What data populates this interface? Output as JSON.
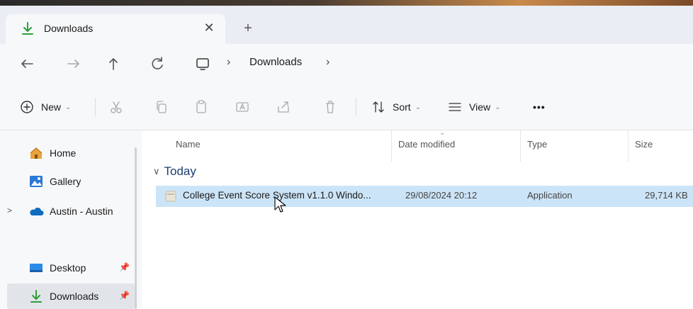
{
  "tab": {
    "icon": "download-arrow-icon",
    "label": "Downloads",
    "close_glyph": "✕",
    "new_tab_glyph": "+"
  },
  "navigation": {
    "back": "back-arrow-icon",
    "forward": "forward-arrow-icon",
    "up": "up-arrow-icon",
    "refresh": "refresh-icon"
  },
  "address_bar": {
    "root_icon": "computer-icon",
    "separator": "›",
    "path": [
      "Downloads"
    ]
  },
  "toolbar": {
    "new_label": "New",
    "sort_label": "Sort",
    "view_label": "View",
    "more_label": "•••",
    "caret": "⌄"
  },
  "sidebar": {
    "items": [
      {
        "label": "Home",
        "icon": "home-icon"
      },
      {
        "label": "Gallery",
        "icon": "gallery-icon"
      },
      {
        "label": "Austin - Austin",
        "icon": "onedrive-cloud-icon"
      },
      {
        "label": "Desktop",
        "icon": "desktop-icon"
      },
      {
        "label": "Downloads",
        "icon": "download-arrow-icon"
      }
    ],
    "expand_glyph": ">",
    "pin_glyph": "📌"
  },
  "columns": {
    "name": "Name",
    "date_modified": "Date modified",
    "type": "Type",
    "size": "Size"
  },
  "groups": [
    {
      "label": "Today",
      "files": [
        {
          "name": "College Event Score System v1.1.0 Windo...",
          "date_modified": "29/08/2024 20:12",
          "type": "Application",
          "size": "29,714 KB"
        }
      ]
    }
  ],
  "colors": {
    "selection": "#cce4f7",
    "accent": "#2f9e3a",
    "group_header": "#1a3c6e"
  }
}
